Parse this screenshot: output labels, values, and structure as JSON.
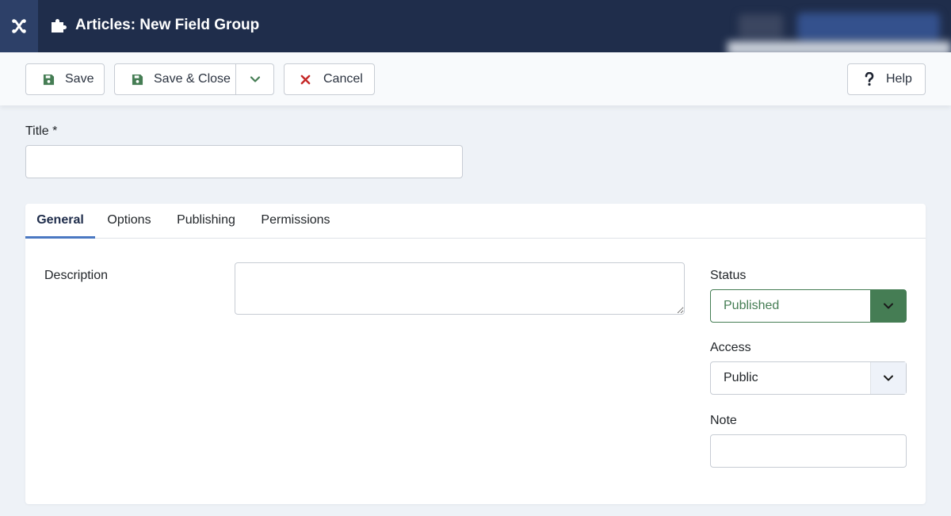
{
  "header": {
    "title": "Articles: New Field Group"
  },
  "toolbar": {
    "save_label": "Save",
    "save_close_label": "Save & Close",
    "cancel_label": "Cancel",
    "help_label": "Help"
  },
  "form": {
    "title_label": "Title *",
    "title_value": ""
  },
  "tabs": [
    {
      "label": "General",
      "active": true
    },
    {
      "label": "Options",
      "active": false
    },
    {
      "label": "Publishing",
      "active": false
    },
    {
      "label": "Permissions",
      "active": false
    }
  ],
  "general": {
    "description_label": "Description",
    "description_value": "",
    "status_label": "Status",
    "status_value": "Published",
    "access_label": "Access",
    "access_value": "Public",
    "note_label": "Note",
    "note_value": ""
  },
  "colors": {
    "header_bg": "#1f2d4b",
    "published_green": "#457d54",
    "cancel_red": "#c52827",
    "tab_active_underline": "#4a78c2"
  },
  "icons": {
    "logo": "joomla-logo-icon",
    "page": "puzzle-piece-icon",
    "save": "floppy-disk-icon",
    "save_close": "floppy-disk-icon",
    "dropdown": "chevron-down-icon",
    "cancel": "close-icon",
    "help": "question-mark-icon"
  }
}
